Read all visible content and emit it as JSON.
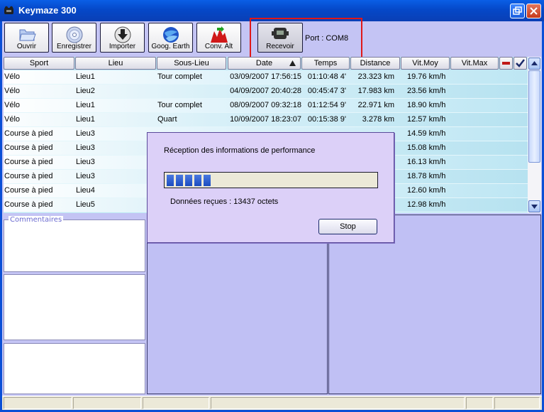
{
  "window": {
    "title": "Keymaze 300"
  },
  "toolbar": {
    "buttons": [
      {
        "label": "Ouvrir",
        "icon": "folder-icon"
      },
      {
        "label": "Enregistrer",
        "icon": "disc-icon"
      },
      {
        "label": "Importer",
        "icon": "import-icon"
      },
      {
        "label": "Goog. Earth",
        "icon": "globe-icon"
      },
      {
        "label": "Conv. Alt",
        "icon": "altitude-icon"
      },
      {
        "label": "Recevoir",
        "icon": "device-icon"
      }
    ],
    "port_label": "Port : COM8"
  },
  "table": {
    "columns": [
      "Sport",
      "Lieu",
      "Sous-Lieu",
      "Date",
      "Temps",
      "Distance",
      "Vit.Moy",
      "Vit.Max"
    ],
    "sort_column": "Date",
    "rows": [
      {
        "sport": "Vélo",
        "lieu": "Lieu1",
        "sous_lieu": "Tour complet",
        "date": "03/09/2007 17:56:15",
        "temps": "01:10:48 4'",
        "distance": "23.323 km",
        "vit_moy": "19.76 km/h"
      },
      {
        "sport": "Vélo",
        "lieu": "Lieu2",
        "sous_lieu": "",
        "date": "04/09/2007 20:40:28",
        "temps": "00:45:47 3'",
        "distance": "17.983 km",
        "vit_moy": "23.56 km/h"
      },
      {
        "sport": "Vélo",
        "lieu": "Lieu1",
        "sous_lieu": "Tour complet",
        "date": "08/09/2007 09:32:18",
        "temps": "01:12:54 9'",
        "distance": "22.971 km",
        "vit_moy": "18.90 km/h"
      },
      {
        "sport": "Vélo",
        "lieu": "Lieu1",
        "sous_lieu": "Quart",
        "date": "10/09/2007 18:23:07",
        "temps": "00:15:38 9'",
        "distance": "3.278 km",
        "vit_moy": "12.57 km/h"
      },
      {
        "sport": "Course à pied",
        "lieu": "Lieu3",
        "sous_lieu": "",
        "date": "",
        "temps": "",
        "distance": "",
        "vit_moy": "14.59 km/h"
      },
      {
        "sport": "Course à pied",
        "lieu": "Lieu3",
        "sous_lieu": "",
        "date": "",
        "temps": "",
        "distance": "",
        "vit_moy": "15.08 km/h"
      },
      {
        "sport": "Course à pied",
        "lieu": "Lieu3",
        "sous_lieu": "",
        "date": "",
        "temps": "",
        "distance": "",
        "vit_moy": "16.13 km/h"
      },
      {
        "sport": "Course à pied",
        "lieu": "Lieu3",
        "sous_lieu": "",
        "date": "",
        "temps": "",
        "distance": "",
        "vit_moy": "18.78 km/h"
      },
      {
        "sport": "Course à pied",
        "lieu": "Lieu4",
        "sous_lieu": "",
        "date": "",
        "temps": "",
        "distance": "",
        "vit_moy": "12.60 km/h"
      },
      {
        "sport": "Course à pied",
        "lieu": "Lieu5",
        "sous_lieu": "",
        "date": "",
        "temps": "",
        "distance": "",
        "vit_moy": "12.98 km/h"
      }
    ]
  },
  "comments": {
    "legend": "Commentaires"
  },
  "dialog": {
    "message": "Réception des informations de performance",
    "progress_blocks": 5,
    "received": "Données reçues : 13437 octets",
    "stop_label": "Stop"
  },
  "colors": {
    "accent_red": "#e01818",
    "titlebar": "#0548c8",
    "table_bg": "#bfe8f4",
    "progress": "#1c4cc0"
  }
}
